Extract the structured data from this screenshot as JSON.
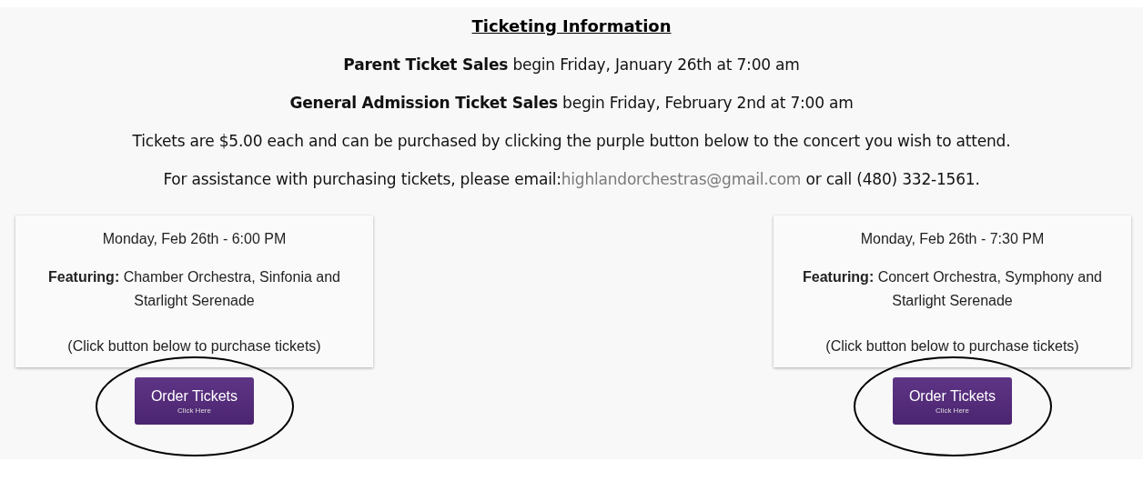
{
  "heading": "Ticketing Information",
  "lines": [
    {
      "text": "**Parent Ticket Sales** begin Friday, January 26th at 7:00 am"
    },
    {
      "text": "**General Admission Ticket Sales** begin Friday, February 2nd at 7:00 am"
    },
    {
      "text": "Tickets are $5.00 each and can be purchased by clicking the purple button below to the concert you wish to attend."
    }
  ],
  "contact": {
    "before": "For assistance with purchasing tickets, please email:",
    "link": "highlandorchestras@gmail.com",
    "after": " or call (480) 332-1561."
  },
  "concerts": [
    {
      "date": "Monday, Feb 26th - 6:00 PM",
      "featuring": "**Featuring:** Chamber Orchestra, Sinfonia and Starlight Serenade",
      "note": "(Click button below to purchase tickets)",
      "button": "Order Tickets",
      "button_sub": "Click Here",
      "circled": true
    },
    {
      "date": "Monday, Feb 26th - 7:30 PM",
      "featuring": "**Featuring:** Concert Orchestra, Symphony and Starlight Serenade",
      "note": "(Click button below to purchase tickets)",
      "button": "Order Tickets",
      "button_sub": "Click Here",
      "circled": true
    }
  ]
}
